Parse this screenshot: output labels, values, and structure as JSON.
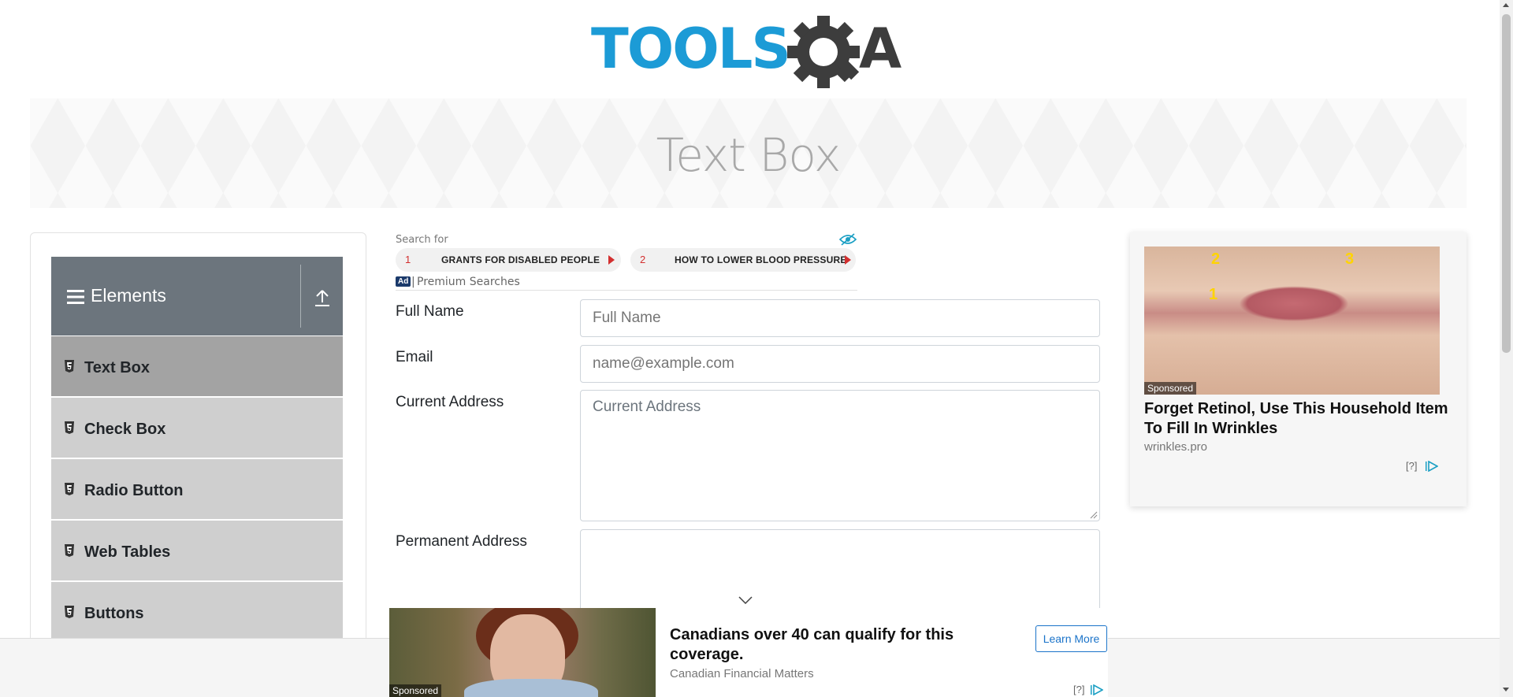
{
  "header": {
    "logo_text_tools": "TOOLS",
    "logo_text_qa": "QA",
    "logo_colors": {
      "tools": "#1c9bd6",
      "qa": "#3d3d3d"
    }
  },
  "banner": {
    "title": "Text Box"
  },
  "sidebar": {
    "group_title": "Elements",
    "group_icon": "hamburger-icon",
    "collapse_icon": "upload-arrow-icon",
    "items": [
      {
        "label": "Text Box",
        "active": true,
        "icon": "html5-icon"
      },
      {
        "label": "Check Box",
        "active": false,
        "icon": "html5-icon"
      },
      {
        "label": "Radio Button",
        "active": false,
        "icon": "html5-icon"
      },
      {
        "label": "Web Tables",
        "active": false,
        "icon": "html5-icon"
      },
      {
        "label": "Buttons",
        "active": false,
        "icon": "html5-icon"
      }
    ],
    "colors": {
      "header": "#6c757d",
      "item": "#cfcfcf",
      "active_item": "#a3a3a3"
    }
  },
  "search_ad": {
    "search_for": "Search for",
    "pills": [
      {
        "num": "1",
        "label": "GRANTS FOR DISABLED PEOPLE"
      },
      {
        "num": "2",
        "label": "HOW TO LOWER BLOOD PRESSURE"
      }
    ],
    "ad_badge": "Ad",
    "separator": "|",
    "premium": "Premium Searches"
  },
  "form": {
    "full_name": {
      "label": "Full Name",
      "placeholder": "Full Name",
      "value": ""
    },
    "email": {
      "label": "Email",
      "placeholder": "name@example.com",
      "value": ""
    },
    "current_address": {
      "label": "Current Address",
      "placeholder": "Current Address",
      "value": ""
    },
    "permanent_address": {
      "label": "Permanent Address",
      "placeholder": "",
      "value": ""
    }
  },
  "right_ad": {
    "sponsored": "Sponsored",
    "headline": "Forget Retinol, Use This Household Item To Fill In Wrinkles",
    "source": "wrinkles.pro",
    "help": "[?]",
    "marks": [
      "1",
      "2",
      "3"
    ]
  },
  "bottom_ad": {
    "sponsored": "Sponsored",
    "headline": "Canadians over 40 can qualify for this coverage.",
    "source": "Canadian Financial Matters",
    "cta": "Learn More",
    "help": "[?]"
  }
}
